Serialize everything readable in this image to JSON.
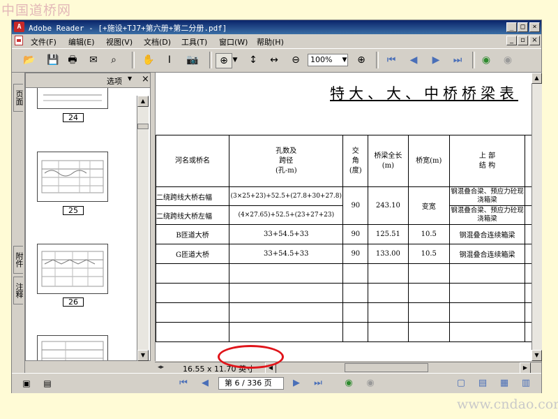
{
  "watermark": {
    "top": "中国道桥网",
    "bottom": "www.cndao.com"
  },
  "window": {
    "app_icon": "adobe-reader-icon",
    "title": "Adobe Reader - [+施设+TJ7+第六册+第二分册.pdf]"
  },
  "menu": [
    "文件(F)",
    "编辑(E)",
    "视图(V)",
    "文档(D)",
    "工具(T)",
    "窗口(W)",
    "帮助(H)"
  ],
  "toolbar": {
    "zoom_value": "100%"
  },
  "sidebar": {
    "tabs": [
      "页面",
      "附件",
      "注释"
    ],
    "options_label": "选项",
    "close_label": "×",
    "thumbnails": [
      "24",
      "25",
      "26"
    ]
  },
  "document": {
    "sheet_title": "特大、大、中桥桥梁表",
    "table_headers": [
      "河名或桥名",
      "孔数及\n跨径\n(孔-m)",
      "交\n角\n(度)",
      "桥梁全长\n(m)",
      "桥宽(m)",
      "上 部\n结 构"
    ],
    "rows": [
      {
        "name": "二绕跨线大桥右幅",
        "spans": "(3×25+23)+52.5+(27.8+30+27.8)",
        "angle": "90",
        "length": "243.10",
        "width": "变宽",
        "structure": "钢混叠合梁、预应力砼现浇箱梁"
      },
      {
        "name": "二绕跨线大桥左幅",
        "spans": "(4×27.65)+52.5+(23+27+23)",
        "angle": "",
        "length": "",
        "width": "",
        "structure": "钢混叠合梁、预应力砼现浇箱梁"
      },
      {
        "name": "B匝道大桥",
        "spans": "33+54.5+33",
        "angle": "90",
        "length": "125.51",
        "width": "10.5",
        "structure": "钢混叠合连续箱梁"
      },
      {
        "name": "G匝道大桥",
        "spans": "33+54.5+33",
        "angle": "90",
        "length": "133.00",
        "width": "10.5",
        "structure": "钢混叠合连续箱梁"
      }
    ]
  },
  "status": {
    "page_size": "16.55 x 11.70 英寸"
  },
  "pagebar": {
    "page_indicator": "第 6 / 336 页"
  },
  "colors": {
    "titlebar": "#0a246a",
    "highlight_oval": "#e0141a",
    "background": "#fffbd6"
  }
}
